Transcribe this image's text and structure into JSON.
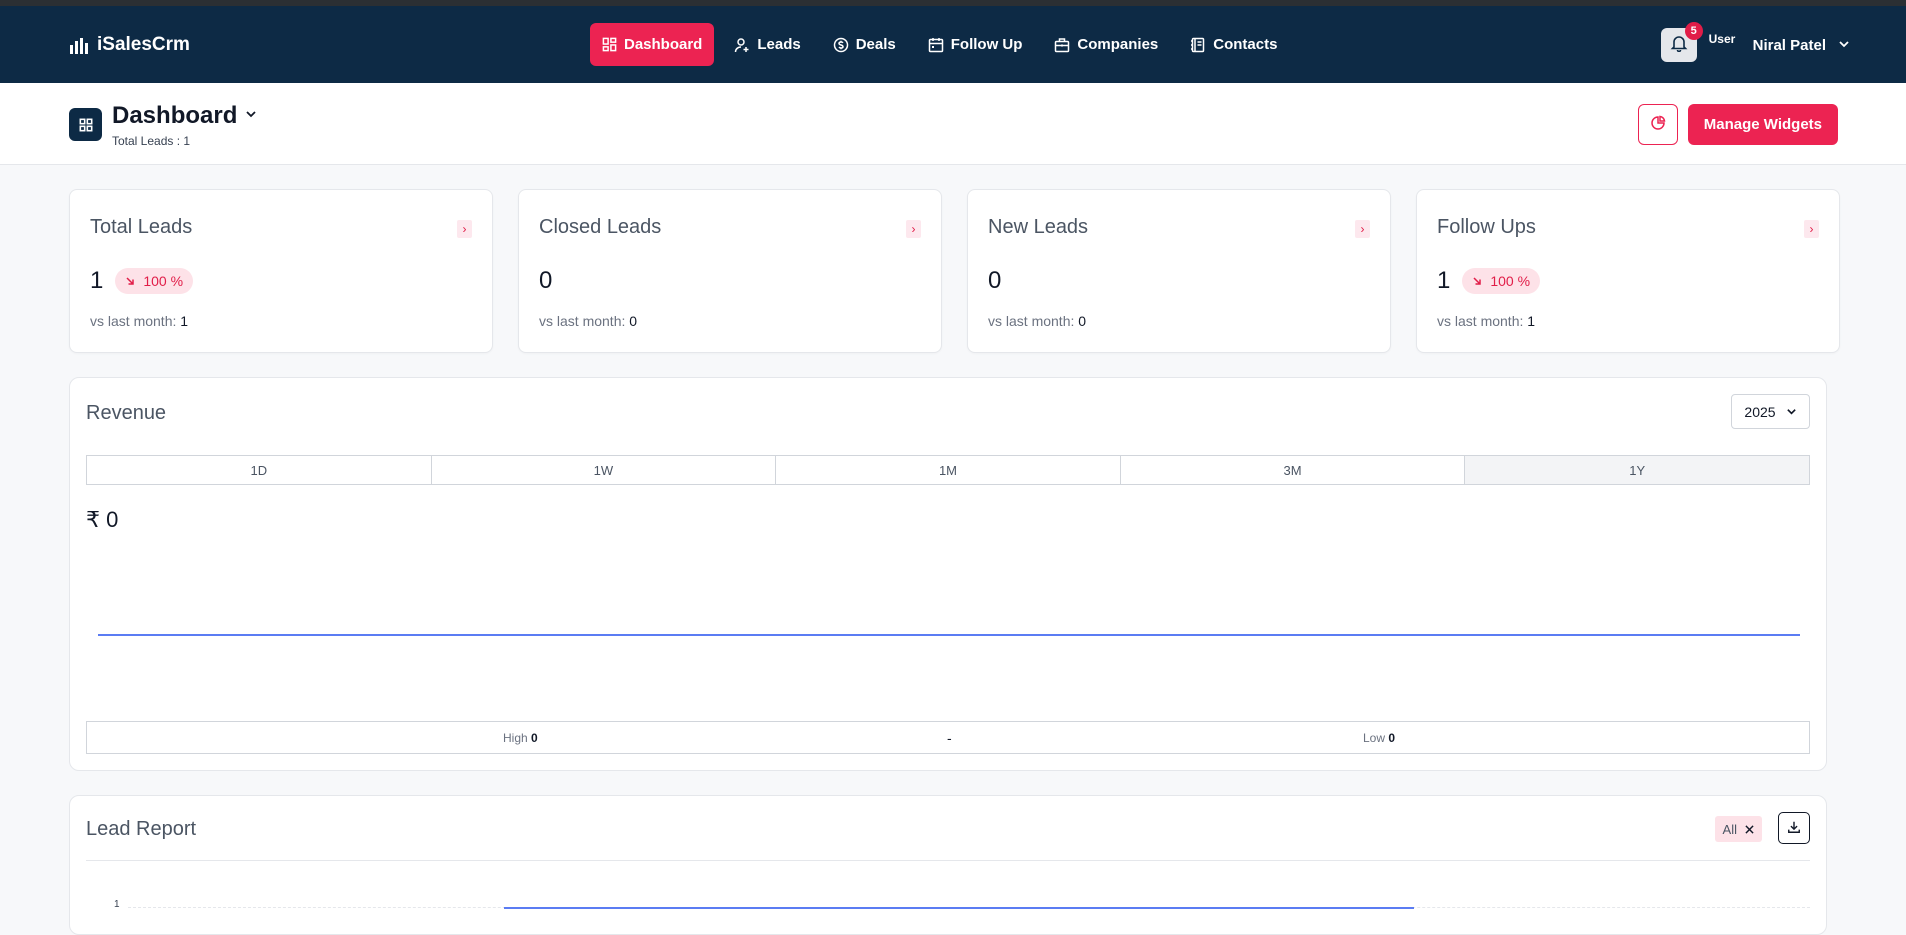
{
  "brand": {
    "name": "iSalesCrm"
  },
  "nav": {
    "items": [
      {
        "label": "Dashboard",
        "icon": "dashboard-icon",
        "active": true
      },
      {
        "label": "Leads",
        "icon": "user-plus-icon",
        "active": false
      },
      {
        "label": "Deals",
        "icon": "dollar-circle-icon",
        "active": false
      },
      {
        "label": "Follow Up",
        "icon": "calendar-icon",
        "active": false
      },
      {
        "label": "Companies",
        "icon": "briefcase-icon",
        "active": false
      },
      {
        "label": "Contacts",
        "icon": "contacts-book-icon",
        "active": false
      }
    ],
    "notifications_count": "5",
    "user_avatar_alt": "User",
    "user_name": "Niral Patel"
  },
  "subheader": {
    "title": "Dashboard",
    "total_leads": "Total Leads : 1",
    "manage_widgets_label": "Manage Widgets"
  },
  "stat_cards": [
    {
      "title": "Total Leads",
      "value": "1",
      "badge": "100 %",
      "vs_label": "vs last month:",
      "vs_value": "1"
    },
    {
      "title": "Closed Leads",
      "value": "0",
      "badge": "",
      "vs_label": "vs last month:",
      "vs_value": "0"
    },
    {
      "title": "New Leads",
      "value": "0",
      "badge": "",
      "vs_label": "vs last month:",
      "vs_value": "0"
    },
    {
      "title": "Follow Ups",
      "value": "1",
      "badge": "100 %",
      "vs_label": "vs last month:",
      "vs_value": "1"
    }
  ],
  "revenue": {
    "title": "Revenue",
    "year": "2025",
    "ranges": [
      "1D",
      "1W",
      "1M",
      "3M",
      "1Y"
    ],
    "active_range": "1Y",
    "amount": "₹ 0",
    "high_label": "High",
    "high_value": "0",
    "separator": "-",
    "low_label": "Low",
    "low_value": "0"
  },
  "lead_report": {
    "title": "Lead Report",
    "filter_label": "All",
    "y_tick": "1"
  },
  "colors": {
    "navbar": "#0d2a45",
    "accent": "#ec2352",
    "line": "#5b7cf3"
  },
  "chart_data": {
    "type": "line",
    "x": [],
    "series": [
      {
        "values": [
          0
        ]
      }
    ],
    "title": "Revenue",
    "xlabel": "",
    "ylabel": ""
  }
}
